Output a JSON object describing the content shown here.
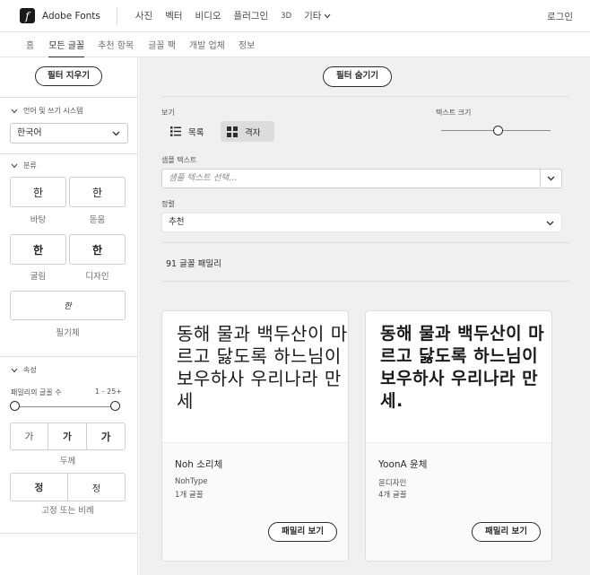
{
  "header": {
    "logo_glyph": "f",
    "brand": "Adobe Fonts",
    "nav": [
      "사진",
      "벡터",
      "비디오",
      "플러그인",
      "3D"
    ],
    "more": "기타",
    "login": "로그인"
  },
  "subnav": {
    "items": [
      "홈",
      "모든 글꼴",
      "추천 항목",
      "글꼴 팩",
      "개발 업체",
      "정보"
    ],
    "active": "모든 글꼴"
  },
  "sidebar": {
    "clear_filters": "필터 지우기",
    "language_section": "언어 및 쓰기 시스템",
    "language_value": "한국어",
    "classification_section": "분류",
    "classes": [
      {
        "glyph": "한",
        "label": "바탕"
      },
      {
        "glyph": "한",
        "label": "돋움"
      },
      {
        "glyph": "한",
        "label": "굴림"
      },
      {
        "glyph": "한",
        "label": "디자인"
      },
      {
        "glyph": "한",
        "label": "필기체"
      }
    ],
    "properties_section": "속성",
    "family_count_label": "패밀리의 글꼴 수",
    "family_count_range": "1 - 25+",
    "weights": [
      "가",
      "가",
      "가"
    ],
    "weight_label": "두께",
    "widths": [
      "정",
      "정"
    ],
    "width_label": "고정 또는 비례"
  },
  "main": {
    "hide_filters": "필터 숨기기",
    "view_label": "보기",
    "view_list": "목록",
    "view_grid": "격자",
    "view_selected": "격자",
    "text_size_label": "텍스트 크기",
    "text_size_fraction": 0.52,
    "sample_label": "샘플 텍스트",
    "sample_placeholder": "샘플 텍스트 선택…",
    "sort_label": "정렬",
    "sort_value": "추천",
    "family_count": "91 글꼴 패밀리"
  },
  "cards": [
    {
      "preview": "동해 물과 백두산이 마르고 닳도록 하느님이 보우하사 우리나라 만세",
      "name": "Noh 소리체",
      "foundry": "NohType",
      "count": "1개 글꼴",
      "button": "패밀리 보기"
    },
    {
      "preview": "동해 물과 백두산이 마르고 닳도록 하느님이 보우하사 우리나라 만세.",
      "name": "YoonA 윤체",
      "foundry": "윤디자인",
      "count": "4개 글꼴",
      "button": "패밀리 보기"
    }
  ]
}
